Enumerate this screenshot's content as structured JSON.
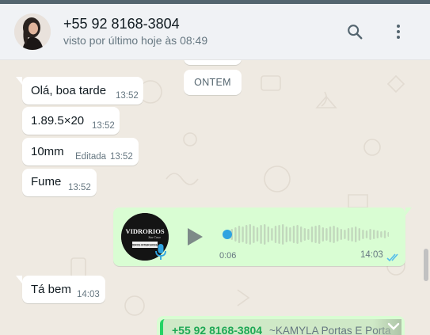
{
  "header": {
    "contact_name": "+55 92 8168-3804",
    "last_seen": "visto por último hoje às 08:49",
    "search_icon": "search-icon",
    "menu_icon": "kebab-menu-icon"
  },
  "chat": {
    "date_separator": "ONTEM",
    "messages": [
      {
        "text": "Olá, boa tarde",
        "time": "13:52"
      },
      {
        "text": "1.89.5×20",
        "time": "13:52"
      },
      {
        "text": "10mm",
        "edited": "Editada",
        "time": "13:52"
      },
      {
        "text": "Fume",
        "time": "13:52"
      }
    ],
    "voice_note": {
      "logo_brand": "VIDRORIOS",
      "logo_tagline": "Sua Casa",
      "logo_banner": "VIDROS INTEIR BOSSA",
      "duration": "0:06",
      "time": "14:03",
      "progress": 0,
      "status": "read"
    },
    "reply": {
      "text": "Tá bem",
      "time": "14:03"
    },
    "forwarded_contact": {
      "name": "+55 92 8168-3804",
      "alias": "~KAMYLA Portas E Porta"
    }
  },
  "colors": {
    "outgoing_bubble": "#d9fdd3",
    "incoming_bubble": "#ffffff",
    "chat_background": "#efeae2",
    "read_ticks": "#53bdeb",
    "header_background": "#f0f2f5"
  }
}
